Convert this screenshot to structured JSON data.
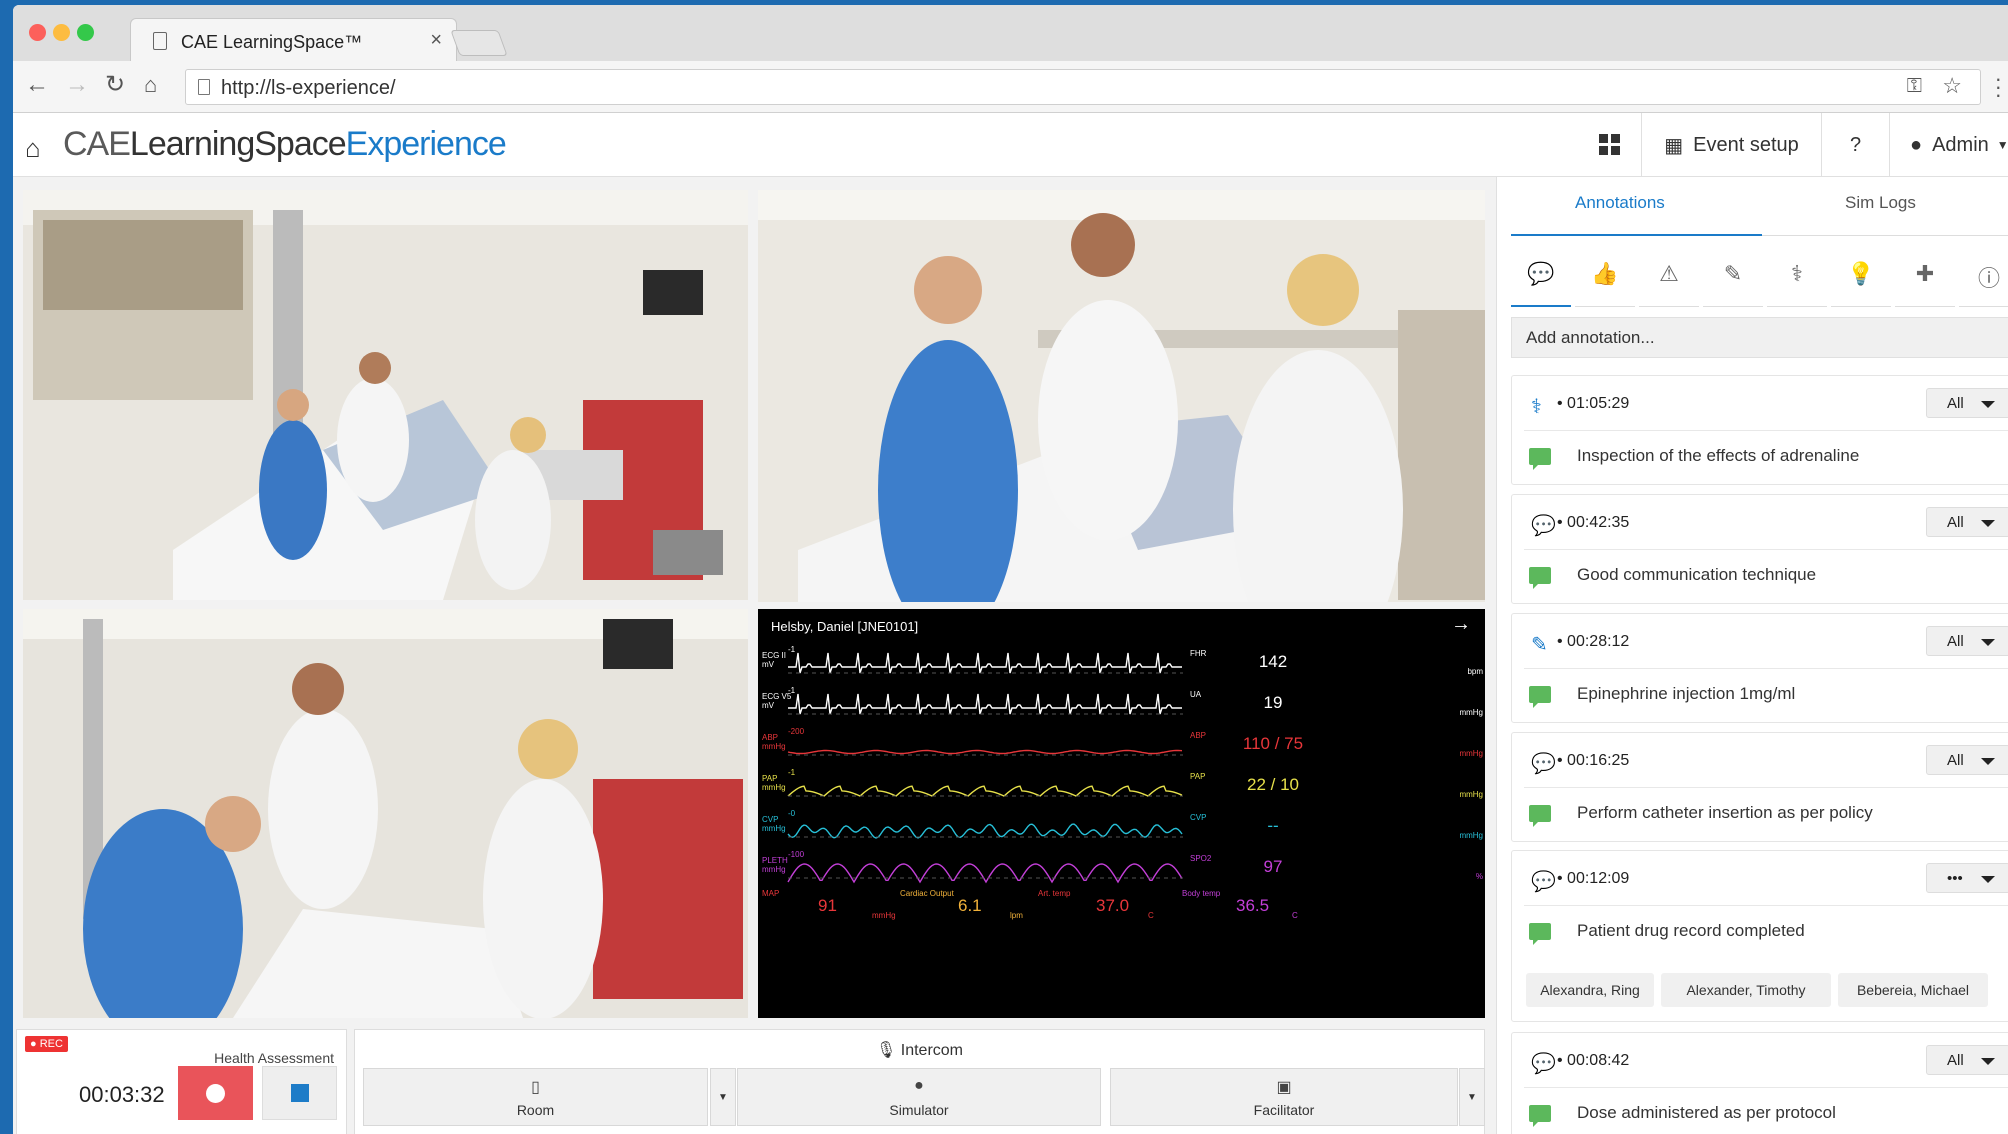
{
  "browser": {
    "tab_title": "CAE LearningSpace™",
    "tab_close": "×",
    "url": "http://ls-experience/"
  },
  "app": {
    "brand_cae": "CAE",
    "brand_learning": "LearningSpace",
    "brand_experience": "Experience",
    "header": {
      "event_setup": "Event setup",
      "help": "?",
      "user": "Admin"
    }
  },
  "monitor": {
    "patient": "Helsby, Daniel [JNE0101]",
    "rows": [
      {
        "label": "ECG II",
        "unit_left": "mV",
        "scale": "-1",
        "param": "FHR",
        "value": "142",
        "unit": "bpm",
        "color": "#ffffff",
        "label_color": "#ffffff"
      },
      {
        "label": "ECG V5",
        "unit_left": "mV",
        "scale": "-1",
        "param": "UA",
        "value": "19",
        "unit": "mmHg",
        "color": "#ffffff",
        "label_color": "#ffffff"
      },
      {
        "label": "ABP",
        "unit_left": "mmHg",
        "scale": "-200",
        "param": "ABP",
        "value": "110 / 75",
        "unit": "mmHg",
        "color": "#e8363a",
        "label_color": "#e8363a"
      },
      {
        "label": "PAP",
        "unit_left": "mmHg",
        "scale": "-1",
        "param": "PAP",
        "value": "22 / 10",
        "unit": "mmHg",
        "color": "#e6e04a",
        "label_color": "#e6e04a"
      },
      {
        "label": "CVP",
        "unit_left": "mmHg",
        "scale": "-0",
        "param": "CVP",
        "value": "--",
        "unit": "mmHg",
        "color": "#27c0d8",
        "label_color": "#27c0d8"
      },
      {
        "label": "PLETH",
        "unit_left": "mmHg",
        "scale": "-100",
        "param": "SPO2",
        "value": "97",
        "unit": "%",
        "color": "#c33fd8",
        "label_color": "#c33fd8"
      }
    ],
    "bottom": [
      {
        "label": "MAP",
        "value": "91",
        "unit": "mmHg",
        "color": "#e8363a"
      },
      {
        "label": "Cardiac Output",
        "value": "6.1",
        "unit": "lpm",
        "color": "#f2b23a"
      },
      {
        "label": "Art. temp",
        "value": "37.0",
        "unit": "C",
        "color": "#e8363a"
      },
      {
        "label": "Body temp",
        "value": "36.5",
        "unit": "C",
        "color": "#c33fd8"
      }
    ]
  },
  "controls": {
    "rec_badge": "● REC",
    "scenario": "Health Assessment",
    "timer": "00:03:32",
    "intercom": "Intercom",
    "channels": [
      "Room",
      "Simulator",
      "Facilitator"
    ]
  },
  "sidebar": {
    "tabs": [
      "Annotations",
      "Sim Logs"
    ],
    "add_placeholder": "Add annotation...",
    "annotations": [
      {
        "icon": "stethoscope-icon",
        "glyph": "⚕",
        "time": "01:05:29",
        "filter": "All",
        "text": "Inspection of the effects of adrenaline"
      },
      {
        "icon": "comment-icon",
        "glyph": "💬",
        "time": "00:42:35",
        "filter": "All",
        "text": "Good communication technique"
      },
      {
        "icon": "syringe-icon",
        "glyph": "✎",
        "time": "00:28:12",
        "filter": "All",
        "text": "Epinephrine injection 1mg/ml"
      },
      {
        "icon": "comment-icon",
        "glyph": "💬",
        "time": "00:16:25",
        "filter": "All",
        "text": "Perform catheter insertion as per policy"
      },
      {
        "icon": "comment-icon",
        "glyph": "💬",
        "time": "00:12:09",
        "filter": "•••",
        "text": "Patient drug record completed"
      },
      {
        "icon": "comment-icon",
        "glyph": "💬",
        "time": "00:08:42",
        "filter": "All",
        "text": "Dose administered as per protocol"
      }
    ],
    "participants": [
      "Alexandra, Ring",
      "Alexander, Timothy",
      "Bebereia, Michael"
    ]
  }
}
